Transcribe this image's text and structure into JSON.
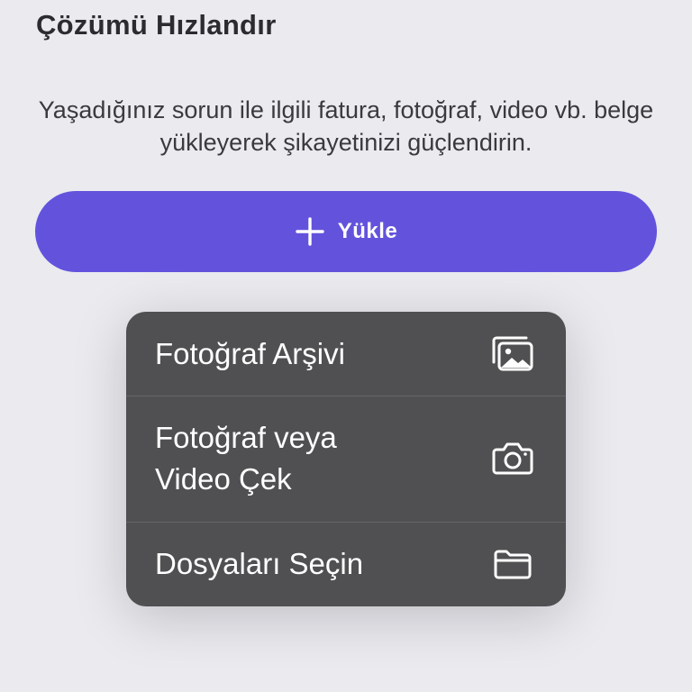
{
  "section": {
    "title": "Çözümü Hızlandır",
    "description": "Yaşadığınız sorun ile ilgili fatura, fotoğraf, video vb. belge yükleyerek şikayetinizi güçlendirin."
  },
  "upload_button": {
    "label": "Yükle",
    "icon": "plus-icon",
    "color": "#6353dc"
  },
  "menu": {
    "background": "#505052",
    "items": [
      {
        "label": "Fotoğraf Arşivi",
        "icon": "photo-library-icon"
      },
      {
        "label": "Fotoğraf veya\nVideo Çek",
        "icon": "camera-icon"
      },
      {
        "label": "Dosyaları Seçin",
        "icon": "folder-icon"
      }
    ]
  }
}
